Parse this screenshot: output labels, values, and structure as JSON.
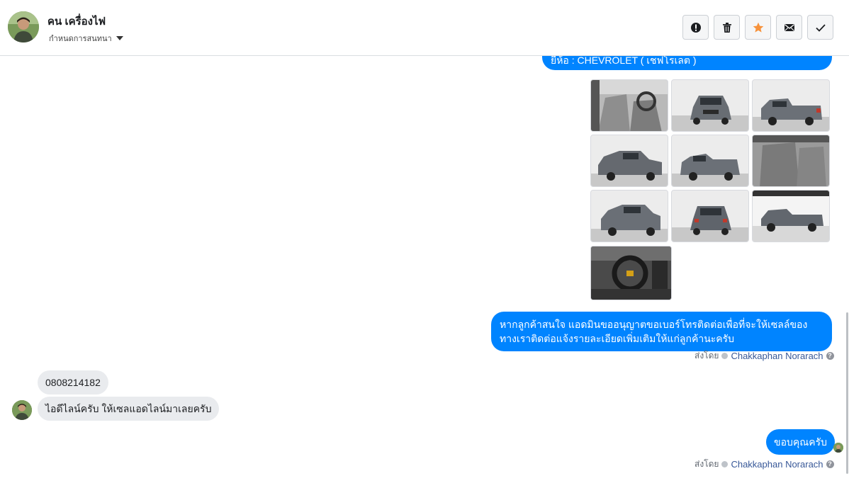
{
  "header": {
    "contact_name": "คน เครื่องไฟ",
    "subtitle": "กำหนดการสนทนา",
    "actions": [
      {
        "name": "report",
        "icon": "alert-circle-icon"
      },
      {
        "name": "delete",
        "icon": "trash-icon"
      },
      {
        "name": "star",
        "icon": "star-icon",
        "color": "#f7923b"
      },
      {
        "name": "mail",
        "icon": "mail-icon"
      },
      {
        "name": "done",
        "icon": "check-icon"
      }
    ]
  },
  "messages": {
    "partial_out": "ยี่ห้อ : CHEVROLET ( เชฟโรเลต )",
    "gallery": {
      "photos": [
        {
          "label": "interior-front-seats"
        },
        {
          "label": "front-view"
        },
        {
          "label": "rear-right-view"
        },
        {
          "label": "front-left-view"
        },
        {
          "label": "rear-left-view"
        },
        {
          "label": "rear-seats"
        },
        {
          "label": "front-angle-view"
        },
        {
          "label": "rear-view"
        },
        {
          "label": "side-view"
        },
        {
          "label": "dashboard-steering"
        }
      ]
    },
    "out_request": "หากลูกค้าสนใจ แอดมินขออนุญาตขอเบอร์โทรติดต่อเพื่อที่จะให้เซลล์ของทางเราติดต่อแจ้งรายละเอียดเพิ่มเติมให้แก่ลูกค้านะครับ",
    "meta1": {
      "prefix": "ส่งโดย",
      "agent": "Chakkaphan Norarach",
      "help": "?"
    },
    "in_phone": "0808214182",
    "in_line": "ไอดีไลน์ครับ ให้เซลแอดไลน์มาเลยครับ",
    "out_thanks": "ขอบคุณครับ",
    "meta2": {
      "prefix": "ส่งโดย",
      "agent": "Chakkaphan Norarach",
      "help": "?"
    }
  },
  "colors": {
    "accent": "#0084ff",
    "incoming": "#e9ebee",
    "agent_link": "#385898"
  }
}
